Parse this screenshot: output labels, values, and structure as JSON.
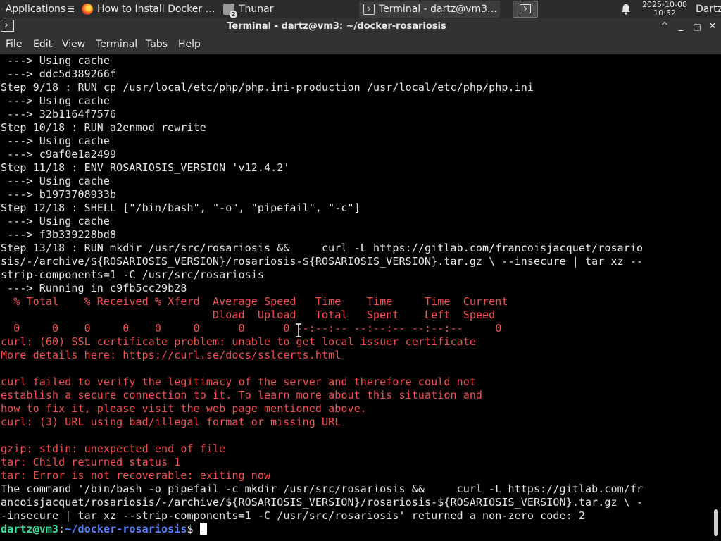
{
  "taskbar": {
    "applications_label": "Applications",
    "tasks": [
      {
        "label": "How to Install Docker o..."
      },
      {
        "label": "Thunar",
        "badge": "2"
      },
      {
        "label": "Terminal - dartz@vm3: ..."
      }
    ],
    "clock_date": "2025-10-08",
    "clock_time": "10:52",
    "user": "Dartz"
  },
  "window": {
    "title": "Terminal - dartz@vm3: ~/docker-rosariosis",
    "controls": {
      "maximize": "^",
      "minimize": "_",
      "restore": "□",
      "close": "✕"
    }
  },
  "menu": [
    "File",
    "Edit",
    "View",
    "Terminal",
    "Tabs",
    "Help"
  ],
  "terminal": {
    "lines": [
      {
        "text": " ---> Using cache",
        "color": "w"
      },
      {
        "text": " ---> ddc5d389266f",
        "color": "w"
      },
      {
        "text": "Step 9/18 : RUN cp /usr/local/etc/php/php.ini-production /usr/local/etc/php/php.ini",
        "color": "w"
      },
      {
        "text": " ---> Using cache",
        "color": "w"
      },
      {
        "text": " ---> 32b1164f7576",
        "color": "w"
      },
      {
        "text": "Step 10/18 : RUN a2enmod rewrite",
        "color": "w"
      },
      {
        "text": " ---> Using cache",
        "color": "w"
      },
      {
        "text": " ---> c9af0e1a2499",
        "color": "w"
      },
      {
        "text": "Step 11/18 : ENV ROSARIOSIS_VERSION 'v12.4.2'",
        "color": "w"
      },
      {
        "text": " ---> Using cache",
        "color": "w"
      },
      {
        "text": " ---> b1973708933b",
        "color": "w"
      },
      {
        "text": "Step 12/18 : SHELL [\"/bin/bash\", \"-o\", \"pipefail\", \"-c\"]",
        "color": "w"
      },
      {
        "text": " ---> Using cache",
        "color": "w"
      },
      {
        "text": " ---> f3b339228bd8",
        "color": "w"
      },
      {
        "text": "Step 13/18 : RUN mkdir /usr/src/rosariosis &&     curl -L https://gitlab.com/francoisjacquet/rosario",
        "color": "w"
      },
      {
        "text": "sis/-/archive/${ROSARIOSIS_VERSION}/rosariosis-${ROSARIOSIS_VERSION}.tar.gz \\ --insecure | tar xz --",
        "color": "w"
      },
      {
        "text": "strip-components=1 -C /usr/src/rosariosis",
        "color": "w"
      },
      {
        "text": " ---> Running in c9fb5cc29b28",
        "color": "w"
      },
      {
        "text": "  % Total    % Received % Xferd  Average Speed   Time    Time     Time  Current",
        "color": "r"
      },
      {
        "text": "                                 Dload  Upload   Total   Spent    Left  Speed",
        "color": "r"
      },
      {
        "text": "  0     0    0     0    0     0      0      0 --:--:-- --:--:-- --:--:--     0",
        "color": "r"
      },
      {
        "text": "curl: (60) SSL certificate problem: unable to get local issuer certificate",
        "color": "r"
      },
      {
        "text": "More details here: https://curl.se/docs/sslcerts.html",
        "color": "r"
      },
      {
        "text": "",
        "color": "r"
      },
      {
        "text": "curl failed to verify the legitimacy of the server and therefore could not",
        "color": "r"
      },
      {
        "text": "establish a secure connection to it. To learn more about this situation and",
        "color": "r"
      },
      {
        "text": "how to fix it, please visit the web page mentioned above.",
        "color": "r"
      },
      {
        "text": "curl: (3) URL using bad/illegal format or missing URL",
        "color": "r"
      },
      {
        "text": "",
        "color": "r"
      },
      {
        "text": "gzip: stdin: unexpected end of file",
        "color": "r"
      },
      {
        "text": "tar: Child returned status 1",
        "color": "r"
      },
      {
        "text": "tar: Error is not recoverable: exiting now",
        "color": "r"
      },
      {
        "text": "The command '/bin/bash -o pipefail -c mkdir /usr/src/rosariosis &&     curl -L https://gitlab.com/fr",
        "color": "w"
      },
      {
        "text": "ancoisjacquet/rosariosis/-/archive/${ROSARIOSIS_VERSION}/rosariosis-${ROSARIOSIS_VERSION}.tar.gz \\ -",
        "color": "w"
      },
      {
        "text": "-insecure | tar xz --strip-components=1 -C /usr/src/rosariosis' returned a non-zero code: 2",
        "color": "w"
      }
    ],
    "prompt": {
      "user_host": "dartz@vm3",
      "sep": ":",
      "path": "~/docker-rosariosis",
      "symbol": "$ "
    }
  },
  "colors": {
    "error_red": "#f0514f",
    "prompt_green": "#3fe0a0",
    "prompt_blue": "#5a83ff",
    "output_white": "#e6e6e6"
  }
}
